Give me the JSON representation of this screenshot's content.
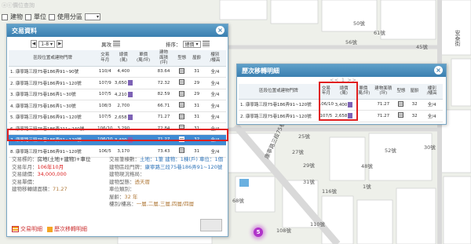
{
  "toolbar": {
    "items": [
      "建物",
      "單位",
      "使用分區"
    ],
    "faded_label": "ⓐⓒ價位查詢"
  },
  "trade_panel": {
    "title": "交易資料",
    "page_value": "1-8",
    "open_label": "異攻",
    "sort_label": "排序：",
    "sort_value": "總價",
    "headers": [
      "區段位置或建物門牌",
      "交易\n年月",
      "總價\n(萬)",
      "單價\n(萬/坪)",
      "建物\n面積\n(坪)",
      "型態",
      "屋齡",
      "樓別\n/樓高"
    ],
    "rows": [
      {
        "no": "1",
        "addr": "康寧路三段75巷186弄91~90號",
        "ym": "110/4",
        "total": "4,400",
        "pi": false,
        "unit": "",
        "area": "83.64",
        "age": "31",
        "floor": "全/4"
      },
      {
        "no": "2",
        "addr": "康寧路三段75巷186弄91~120號",
        "ym": "107/9",
        "total": "3,650",
        "pi": true,
        "unit": "",
        "area": "72.32",
        "age": "29",
        "floor": "全/4"
      },
      {
        "no": "3",
        "addr": "康寧路三段75巷186弄1~30號",
        "ym": "107/5",
        "total": "4,210",
        "pi": true,
        "unit": "",
        "area": "82.59",
        "age": "29",
        "floor": "全/4"
      },
      {
        "no": "4",
        "addr": "康寧路三段75巷186弄1~30號",
        "ym": "108/3",
        "total": "2,700",
        "pi": false,
        "unit": "",
        "area": "66.71",
        "age": "31",
        "floor": "全/4"
      },
      {
        "no": "5",
        "addr": "康寧路三段75巷186弄91~120號",
        "ym": "107/5",
        "total": "2,658",
        "pi": true,
        "unit": "",
        "area": "71.27",
        "age": "31",
        "floor": "全/4"
      },
      {
        "no": "6",
        "addr": "康寧路三段75巷186弄211~240號",
        "ym": "106/10",
        "total": "3,290",
        "pi": false,
        "unit": "",
        "area": "72.84",
        "age": "31",
        "floor": "全/4"
      },
      {
        "no": "7",
        "addr": "康寧路三段75巷186弄91~120號",
        "ym": "106/10",
        "total": "3,400",
        "pi": true,
        "unit": "",
        "area": "71.27",
        "age": "32",
        "floor": "全/4"
      },
      {
        "no": "8",
        "addr": "康寧路三段75巷186弄91~120號",
        "ym": "106/5",
        "total": "3,170",
        "pi": false,
        "unit": "",
        "area": "73.43",
        "age": "31",
        "floor": "全/4"
      }
    ],
    "details_left": [
      {
        "label": "交易標的：",
        "value": "房地(土地+建物)+車位",
        "color": "normal"
      },
      {
        "label": "交易年月：",
        "value": "106年10月",
        "color": "red"
      },
      {
        "label": "交易總價：",
        "value": "34,000,000",
        "color": "red"
      },
      {
        "label": "交易單價：",
        "value": "",
        "color": "normal"
      },
      {
        "label": "建物移轉總面積：",
        "value": "71.27",
        "color": "tan"
      }
    ],
    "details_right": [
      {
        "label": "交易筆棟數：",
        "value": "土地：1筆 建物：1棟(戶) 車位：1個",
        "color": "blue"
      },
      {
        "label": "建物區段門牌：",
        "value": "康寧路三段75巷186弄91~120號",
        "color": "blue"
      },
      {
        "label": "建物現況格局：",
        "value": "",
        "color": "normal"
      },
      {
        "label": "建物型態：",
        "value": "透天厝",
        "color": "tan"
      },
      {
        "label": "車位類別：",
        "value": "",
        "color": "normal"
      },
      {
        "label": "屋齡：",
        "value": "32 年",
        "color": "tan"
      },
      {
        "label": "樓別/樓高：",
        "value": "一層,二層,三層,四層/四層",
        "color": "tan"
      }
    ],
    "bottom_buttons": [
      "交易明細",
      "歷次移轉明細"
    ]
  },
  "trans_panel": {
    "title": "歷次移轉明細",
    "pager": "<< 1 >>",
    "headers": [
      "區段位置或建物門牌",
      "交易\n年月",
      "總價\n(萬)",
      "單價\n(萬/坪)",
      "建物面積\n(坪)",
      "型態",
      "屋齡",
      "樓別\n/樓高"
    ],
    "rows": [
      {
        "no": "1",
        "addr": "康寧路三段75巷186弄91~120號",
        "ym": "106/10",
        "total": "3,400",
        "area": "71.27",
        "age": "32",
        "floor": "全/4"
      },
      {
        "no": "2",
        "addr": "康寧路三段75巷186弄91~120號",
        "ym": "107/5",
        "total": "2,658",
        "area": "71.27",
        "age": "32",
        "floor": "全/4"
      }
    ]
  },
  "map_labels": {
    "street_right": "安泰街",
    "street_diag": "康寧路三段75巷",
    "house_nums": [
      "56號",
      "50號",
      "61號",
      "45號",
      "30號",
      "52號",
      "48號",
      "1號",
      "116號",
      "110號",
      "108號",
      "68號",
      "25號",
      "27號",
      "29號",
      "31號"
    ],
    "poi": "5"
  },
  "colors": {
    "header": "#3a7fb0",
    "highlight": "#3e8ad3",
    "box": "#e02020",
    "poi": "#b033c9"
  }
}
